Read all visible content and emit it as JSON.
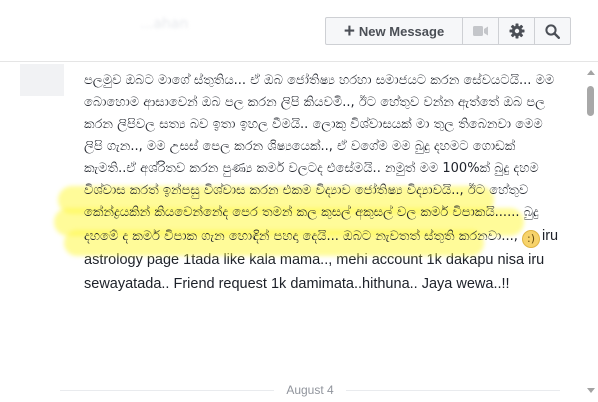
{
  "header": {
    "sender_name": "...ahan"
  },
  "toolbar": {
    "new_message_label": "New Message",
    "new_message_icon": "plus-icon",
    "video_icon": "video-camera-icon",
    "settings_icon": "gear-icon",
    "search_icon": "search-icon"
  },
  "message": {
    "text_sinhala": "පලමුව ඔබට මාගේ ස්තුතිය... ඒ ඔබ ජෝතිෂ්‍ය හරහා සමාජයට කරන සේවයටයි... මම බොහොම ආසාවෙන් ඔබ පල කරන ලිපි කියවමි.., ඊට හේතුව වන්න ඇත්තේ ඔබ පල කරන ලිපිවල සත්‍ය බව ඉතා ඉහල වීමයි.. ලොකු විශ්වාසයක් මා තුල තිබෙනවා මෙම ලිපි ගැන.., මම උසස් පෙල කරන ශිෂ්‍යයෙක්.., ඒ වගේම මම බුදු දහමට ගොඩක් කැමති..ඒ අශ්රිතව කරන පුණ්‍ය කර්ම වලටද එසේමයි.. නමුත් මම 100%ක් බුදු දහම විශ්වාස කරත් ඉන්පසු විශ්වාස කරන එකම විද්‍යාව ජෝතිෂ්‍ය විද්‍යාවයි.., ඊට හේතුව කේන්ද්‍රයකින් කියවෙන්නේද පෙර තමන් කල කුසල් අකුසල් වල කර්ම විපාකයි...... බුදු දහමේ ද කර්ම විපාක ගැන හොඳින් පහදා දෙයි... ඔබට නැවතත් ස්තුති කරනවා..., ",
    "smiley_glyph": ":)",
    "text_latin": "iru astrology page 1tada like kala mama.., mehi account 1k dakapu nisa iru sewayatada.. Friend request 1k damimata..hithuna.. Jaya wewa..!!"
  },
  "date_separator": {
    "label": "August 4"
  }
}
